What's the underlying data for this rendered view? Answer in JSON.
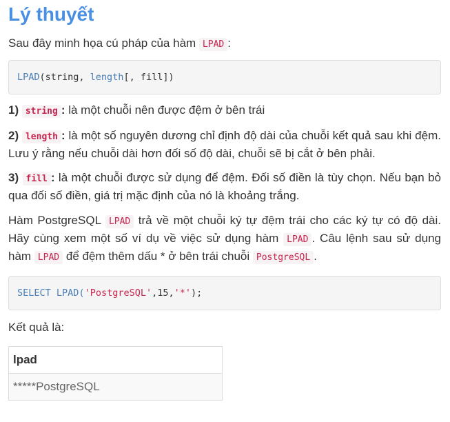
{
  "heading": "Lý thuyết",
  "intro": {
    "text": "Sau đây minh họa cú pháp của hàm",
    "code": "LPAD",
    "end": ":"
  },
  "syntax": {
    "fn": "LPAD",
    "open": "(string, ",
    "length": "length",
    "rest": "[, fill])"
  },
  "params": [
    {
      "num": "1)",
      "code": "string",
      "colon": ":",
      "text": " là một chuỗi nên được đệm ở bên trái"
    },
    {
      "num": "2)",
      "code": "length",
      "colon": ":",
      "text": " là một số nguyên dương chỉ định độ dài của chuỗi kết quả sau khi đệm. Lưu ý rằng nếu chuỗi dài hơn đối số độ dài, chuỗi sẽ bị cắt ở bên phải."
    },
    {
      "num": "3)",
      "code": "fill",
      "colon": ":",
      "text": " là một chuỗi được sử dụng để đệm. Đối số điền là tùy chọn. Nếu bạn bỏ qua đối số điền, giá trị mặc định của nó là khoảng trắng."
    }
  ],
  "description": {
    "t1": "Hàm PostgreSQL",
    "c1": "LPAD",
    "t2": "trả về một chuỗi ký tự đệm trái cho các ký tự có độ dài. Hãy cùng xem một số ví dụ về việc sử dụng hàm",
    "c2": "LPAD",
    "t3": ". Câu lệnh sau sử dụng hàm",
    "c3": "LPAD",
    "t4": "để đệm thêm dấu * ở bên trái chuỗi",
    "c4": "PostgreSQL",
    "t5": "."
  },
  "example": {
    "select": "SELECT",
    "fn": " LPAD(",
    "arg1": "'PostgreSQL'",
    "mid": ",15,",
    "arg3": "'*'",
    "close": ");"
  },
  "result_label": "Kết quả là:",
  "result_table": {
    "header": "lpad",
    "value": "*****PostgreSQL"
  }
}
